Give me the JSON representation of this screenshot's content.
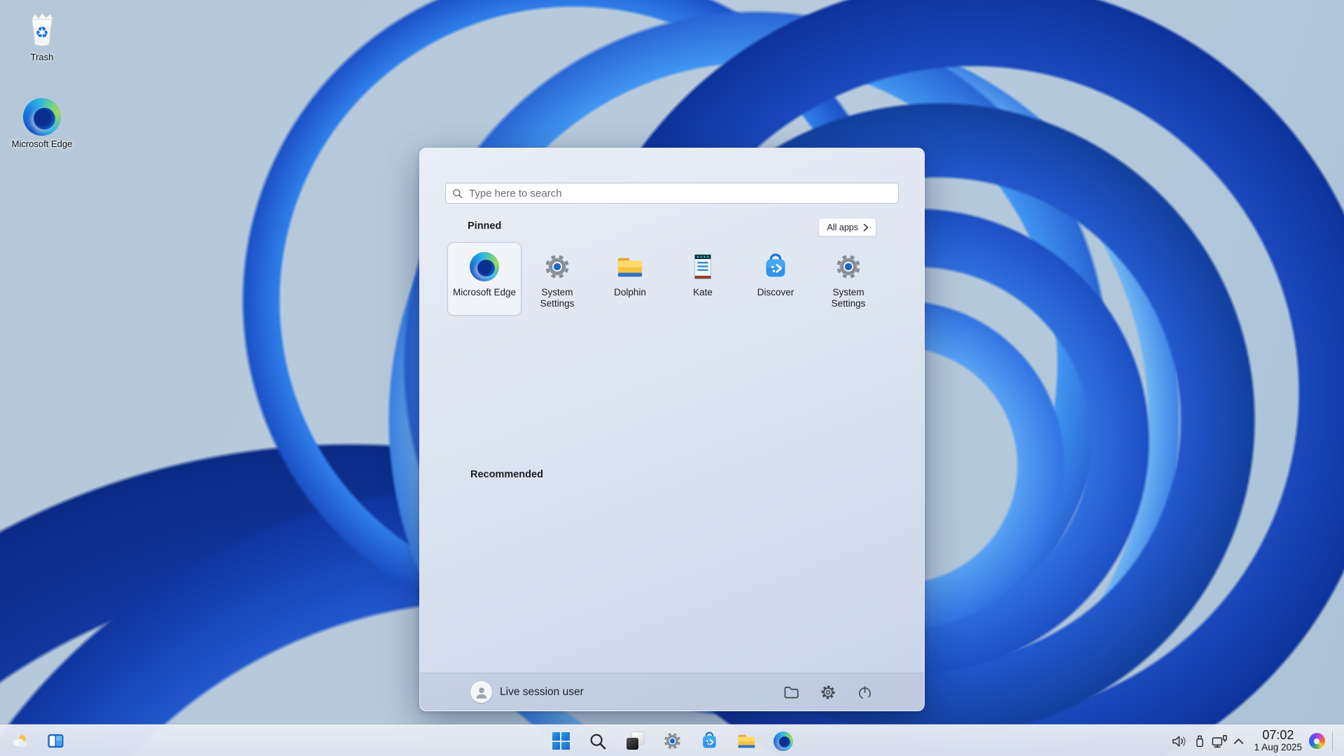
{
  "desktop": {
    "icons": [
      {
        "label": "Trash",
        "icon": "trash-icon"
      },
      {
        "label": "Microsoft Edge",
        "icon": "edge-icon"
      }
    ]
  },
  "start_menu": {
    "search_placeholder": "Type here to search",
    "pinned_title": "Pinned",
    "all_apps_label": "All apps",
    "recommended_title": "Recommended",
    "pinned_apps": [
      {
        "label": "Microsoft Edge",
        "icon": "edge-icon",
        "selected": true
      },
      {
        "label": "System Settings",
        "icon": "system-settings-icon",
        "selected": false
      },
      {
        "label": "Dolphin",
        "icon": "dolphin-folder-icon",
        "selected": false
      },
      {
        "label": "Kate",
        "icon": "kate-notepad-icon",
        "selected": false
      },
      {
        "label": "Discover",
        "icon": "discover-bag-icon",
        "selected": false
      },
      {
        "label": "System Settings",
        "icon": "system-settings-icon",
        "selected": false
      }
    ],
    "user": {
      "name": "Live session user",
      "avatar": "user-avatar-icon"
    },
    "footer_icons": [
      "folder-icon",
      "settings-gear-icon",
      "power-icon"
    ]
  },
  "taskbar": {
    "left_icons": [
      "weather-icon",
      "panel-peek-icon"
    ],
    "center_icons": [
      "start-button",
      "search-icon",
      "task-view-icon",
      "system-settings-icon",
      "discover-bag-icon",
      "dolphin-folder-icon",
      "edge-icon"
    ],
    "tray": {
      "icons": [
        "volume-icon",
        "usb-drive-icon",
        "display-connect-icon",
        "chevron-up-icon"
      ],
      "time": "07:02",
      "date": "1 Aug 2025",
      "assistant_icon": "copilot-icon"
    }
  },
  "colors": {
    "wallpaper_base": "#b5c8da",
    "bloom_deep_blue": "#0e339b",
    "bloom_bright_blue": "#57a0f3",
    "menu_top": "#eaeef6",
    "menu_bottom": "#c9d4e8",
    "taskbar_bg": "#e4e8f1",
    "accent_blue": "#1668c8"
  }
}
